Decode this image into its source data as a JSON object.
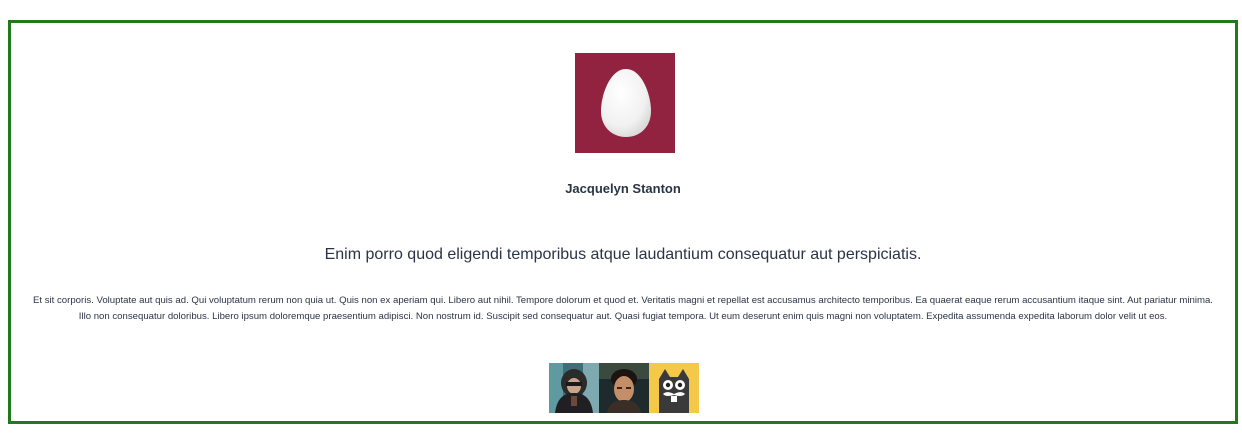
{
  "profile": {
    "name": "Jacquelyn Stanton",
    "avatar_icon": "egg-icon",
    "avatar_bg": "#922340"
  },
  "post": {
    "headline": "Enim porro quod eligendi temporibus atque laudantium consequatur aut perspiciatis.",
    "body": "Et sit corporis. Voluptate aut quis ad. Qui voluptatum rerum non quia ut. Quis non ex aperiam qui. Libero aut nihil. Tempore dolorum et quod et. Veritatis magni et repellat est accusamus architecto temporibus. Ea quaerat eaque rerum accusantium itaque sint. Aut pariatur minima. Illo non consequatur doloribus. Libero ipsum doloremque praesentium adipisci. Non nostrum id. Suscipit sed consequatur aut. Quasi fugiat tempora. Ut eum deserunt enim quis magni non voluptatem. Expedita assumenda expedita laborum dolor velit ut eos."
  },
  "thumbnails": [
    {
      "icon": "photo-person-hood-icon"
    },
    {
      "icon": "photo-person-portrait-icon"
    },
    {
      "icon": "cat-mustache-icon"
    }
  ],
  "colors": {
    "border": "#1f7a1a",
    "text": "#2b3445"
  }
}
